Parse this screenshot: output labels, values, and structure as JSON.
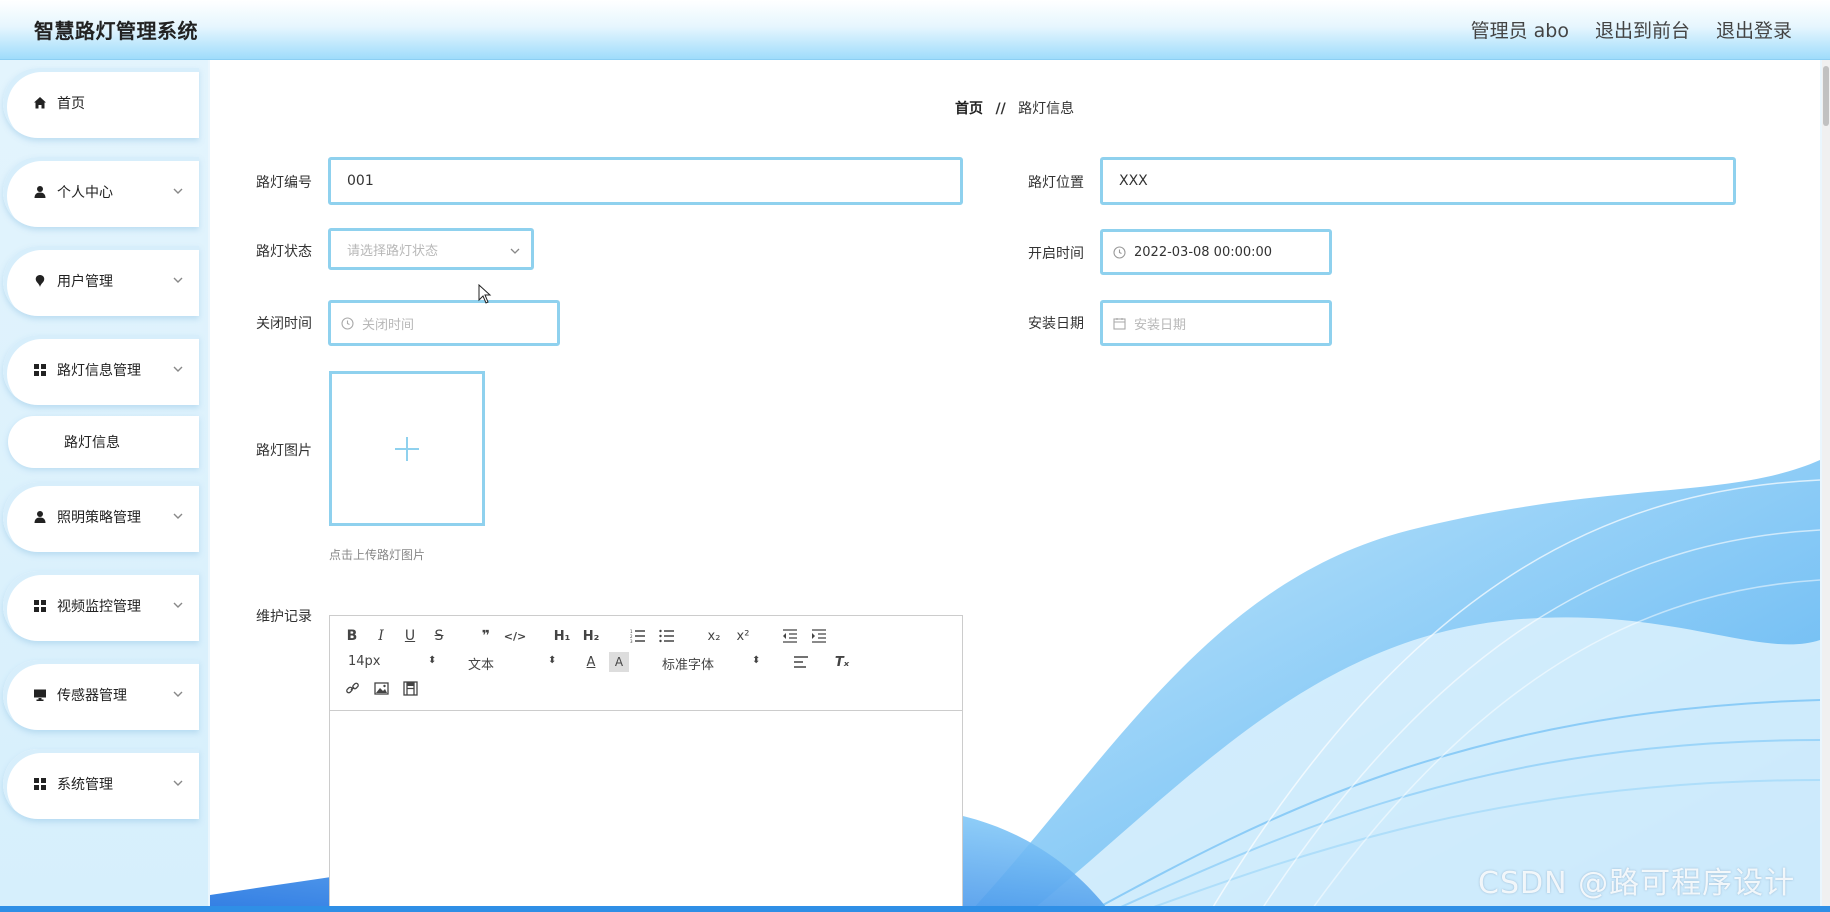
{
  "header": {
    "title": "智慧路灯管理系统",
    "admin": "管理员 abo",
    "to_front": "退出到前台",
    "logout": "退出登录"
  },
  "sidebar": {
    "items": [
      {
        "label": "首页",
        "icon": "home-icon"
      },
      {
        "label": "个人中心",
        "icon": "user-icon"
      },
      {
        "label": "用户管理",
        "icon": "pin-icon"
      },
      {
        "label": "路灯信息管理",
        "icon": "grid-icon"
      },
      {
        "label": "照明策略管理",
        "icon": "user-icon"
      },
      {
        "label": "视频监控管理",
        "icon": "grid-icon"
      },
      {
        "label": "传感器管理",
        "icon": "monitor-icon"
      },
      {
        "label": "系统管理",
        "icon": "grid-icon"
      }
    ],
    "sub_item": "路灯信息"
  },
  "breadcrumb": {
    "home": "首页",
    "sep": "//",
    "current": "路灯信息"
  },
  "form": {
    "lamp_no_label": "路灯编号",
    "lamp_no_value": "001",
    "location_label": "路灯位置",
    "location_value": "XXX",
    "status_label": "路灯状态",
    "status_placeholder": "请选择路灯状态",
    "open_time_label": "开启时间",
    "open_time_value": "2022-03-08 00:00:00",
    "close_time_label": "关闭时间",
    "close_time_placeholder": "关闭时间",
    "install_date_label": "安装日期",
    "install_date_placeholder": "安装日期",
    "image_label": "路灯图片",
    "upload_hint": "点击上传路灯图片",
    "maintenance_label": "维护记录"
  },
  "editor": {
    "font_size": "14px",
    "header_select": "文本",
    "font_family": "标准字体"
  },
  "watermark": "CSDN @路可程序设计",
  "colors": {
    "accent": "#8fd1ee",
    "header_bottom": "#9fdcfb",
    "sidebar_bg": "#d6effc"
  }
}
